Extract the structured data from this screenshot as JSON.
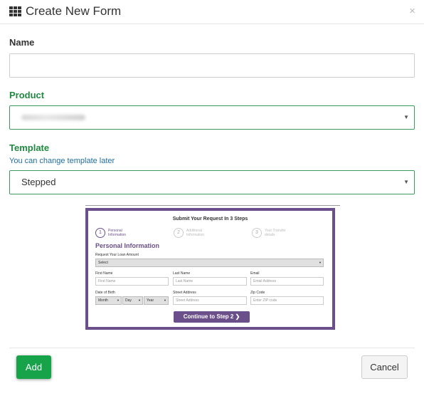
{
  "modal": {
    "title": "Create New Form",
    "close_glyph": "×"
  },
  "fields": {
    "name": {
      "label": "Name",
      "value": "",
      "placeholder": ""
    },
    "product": {
      "label": "Product"
    },
    "template": {
      "label": "Template",
      "help": "You can change template later",
      "value": "Stepped"
    }
  },
  "preview": {
    "title": "Submit Your Request In 3 Steps",
    "steps": [
      {
        "num": "1",
        "line1": "Personal",
        "line2": "Information"
      },
      {
        "num": "2",
        "line1": "Additional",
        "line2": "Information"
      },
      {
        "num": "3",
        "line1": "Your Transfer",
        "line2": "details"
      }
    ],
    "heading": "Personal Information",
    "loan_label": "Request Your Loan Amount",
    "loan_select": "Select",
    "first_name_label": "First Name",
    "first_name_placeholder": "First Name",
    "last_name_label": "Last Name",
    "last_name_placeholder": "Last Name",
    "email_label": "Email",
    "email_placeholder": "Email Address",
    "dob_label": "Date of Birth",
    "month": "Month",
    "day": "Day",
    "year": "Year",
    "street_label": "Street Address",
    "street_placeholder": "Street Address",
    "zip_label": "Zip Code",
    "zip_placeholder": "Enter ZIP code",
    "button": "Continue to Step 2 ❯"
  },
  "footer": {
    "add": "Add",
    "cancel": "Cancel"
  },
  "colors": {
    "accent_green": "#16a34a",
    "label_green": "#1f8a3f",
    "preview_purple": "#6b4f8a"
  },
  "icons": {
    "title_icon": "grid-icon",
    "caret": "caret-down-icon"
  }
}
